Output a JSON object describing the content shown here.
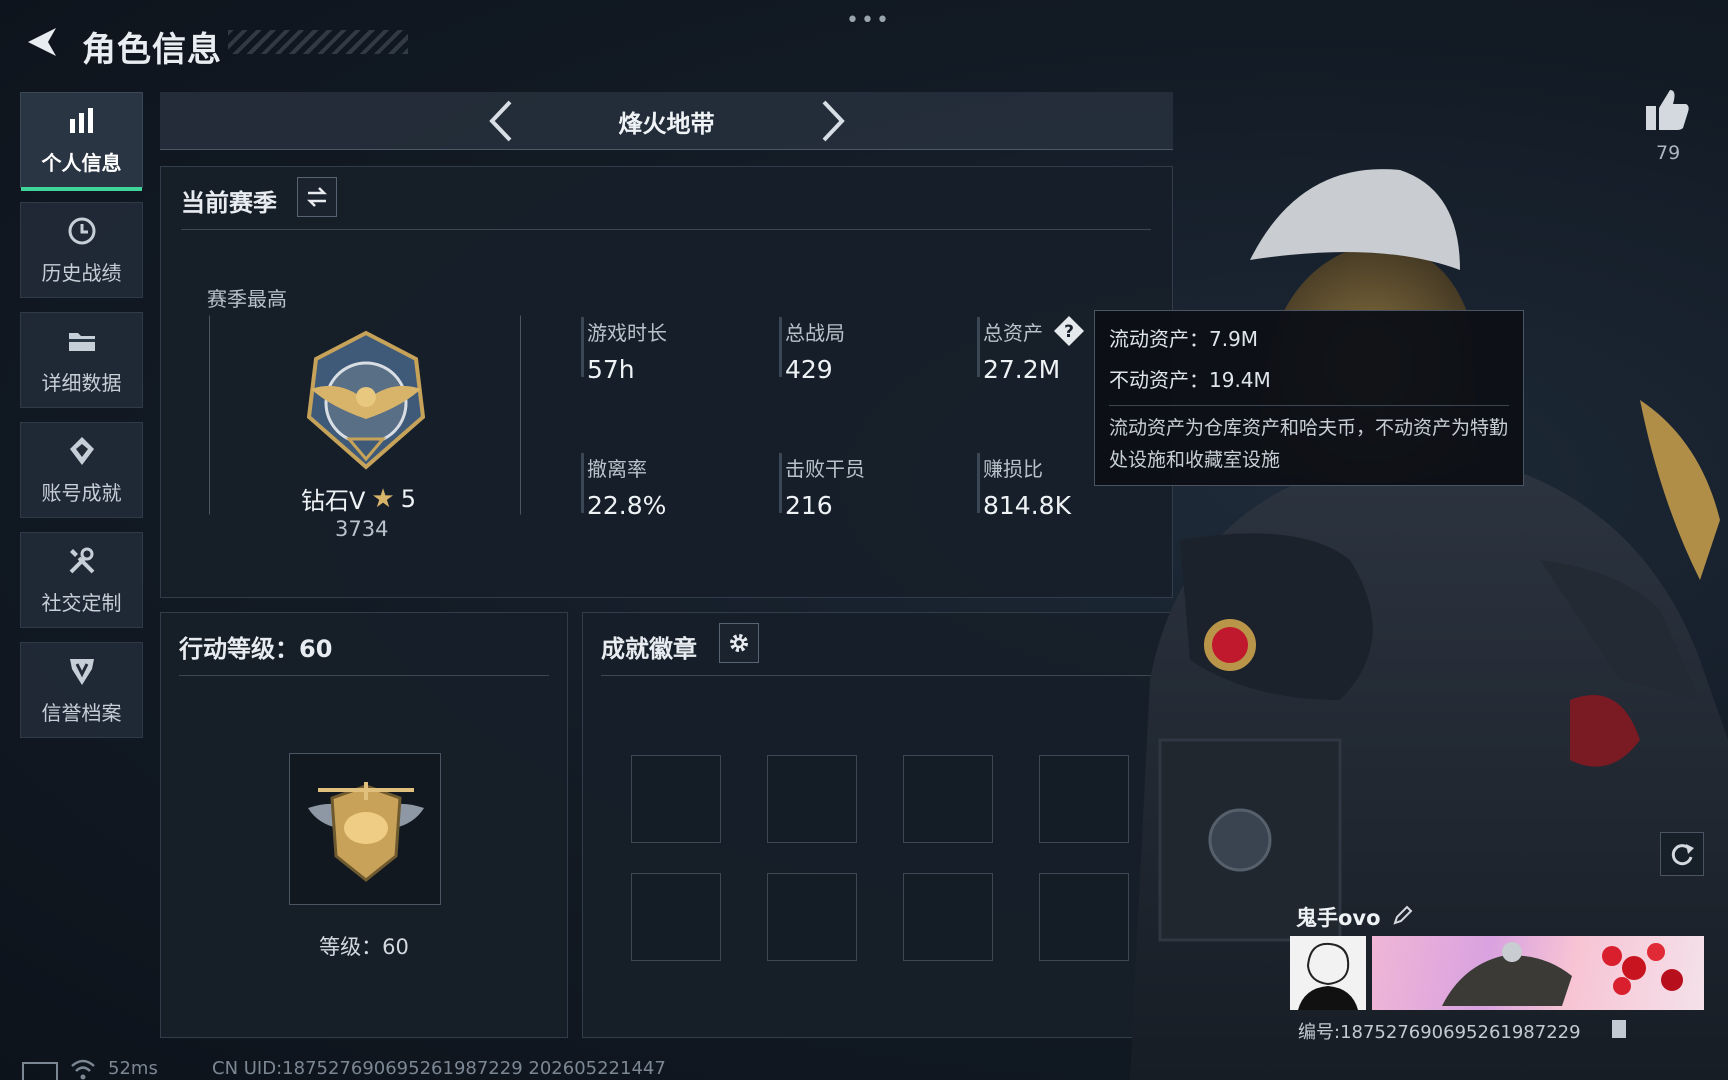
{
  "header": {
    "title": "角色信息",
    "menu_dots": "•••"
  },
  "sidebar": {
    "items": [
      {
        "label": "个人信息",
        "icon": "bar-chart-icon",
        "active": true
      },
      {
        "label": "历史战绩",
        "icon": "history-clock-icon",
        "active": false
      },
      {
        "label": "详细数据",
        "icon": "folder-icon",
        "active": false
      },
      {
        "label": "账号成就",
        "icon": "medal-icon",
        "active": false
      },
      {
        "label": "社交定制",
        "icon": "tools-icon",
        "active": false
      },
      {
        "label": "信誉档案",
        "icon": "shield-icon",
        "active": false
      }
    ]
  },
  "mode_selector": {
    "current": "烽火地带"
  },
  "season": {
    "title": "当前赛季",
    "best_label": "赛季最高",
    "rank_name": "钻石V",
    "rank_stars": "5",
    "rank_points": "3734",
    "stats": [
      {
        "label": "游戏时长",
        "value": "57h"
      },
      {
        "label": "总战局",
        "value": "429"
      },
      {
        "label": "总资产",
        "value": "27.2M",
        "has_help": true
      },
      {
        "label": "撤离率",
        "value": "22.8%"
      },
      {
        "label": "击败干员",
        "value": "216"
      },
      {
        "label": "赚损比",
        "value": "814.8K"
      }
    ]
  },
  "tooltip": {
    "liquid": "流动资产：7.9M",
    "fixed": "不动资产：19.4M",
    "desc": "流动资产为仓库资产和哈夫币，不动资产为特勤处设施和收藏室设施"
  },
  "level_panel": {
    "title": "行动等级：60",
    "level_text": "等级：60"
  },
  "badges_panel": {
    "title": "成就徽章",
    "slot_count": 8
  },
  "profile": {
    "likes": "79",
    "nickname": "鬼手ovo",
    "id_label": "编号:187527690695261987229"
  },
  "footer": {
    "ping": "52ms",
    "uid": "CN UID:187527690695261987229  202605221447"
  },
  "colors": {
    "accent": "#3fd49a",
    "gold": "#d8b46a",
    "bg": "#121a24"
  }
}
